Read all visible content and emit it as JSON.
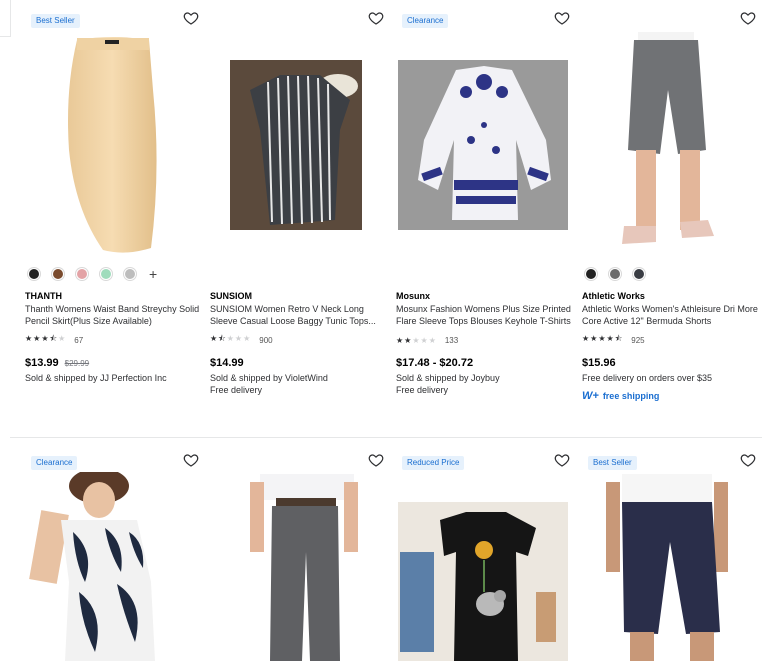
{
  "row1": [
    {
      "badge": "Best Seller",
      "swatches": [
        "#222222",
        "#7a4b2e",
        "#e3a3a6",
        "#9fdcbc",
        "#bdbdbd"
      ],
      "more": "+",
      "brand": "THANTH",
      "title": "Thanth Womens Waist Band Streychy Solid Pencil Skirt(Plus Size Available)",
      "stars": 3.5,
      "reviews": "67",
      "price": "$13.99",
      "was": "$29.99",
      "shipping": [
        "Sold & shipped by JJ Perfection Inc"
      ]
    },
    {
      "badge": "",
      "swatches": [],
      "brand": "SUNSIOM",
      "title": "SUNSIOM Women Retro V Neck Long Sleeve Casual Loose Baggy Tunic Tops...",
      "stars": 1.5,
      "reviews": "900",
      "price": "$14.99",
      "was": "",
      "shipping": [
        "Sold & shipped by VioletWind",
        "Free delivery"
      ]
    },
    {
      "badge": "Clearance",
      "swatches": [],
      "brand": "Mosunx",
      "title": "Mosunx Fashion Womens Plus Size Printed Flare Sleeve Tops Blouses Keyhole T-Shirts",
      "stars": 2,
      "reviews": "133",
      "price": "$17.48 - $20.72",
      "was": "",
      "shipping": [
        "Sold & shipped by Joybuy",
        "Free delivery"
      ]
    },
    {
      "badge": "",
      "swatches": [
        "#222222",
        "#6b6b6b",
        "#3a3d44"
      ],
      "brand": "Athletic Works",
      "title": "Athletic Works Women's Athleisure Dri More Core Active 12\" Bermuda Shorts",
      "stars": 4.5,
      "reviews": "925",
      "price": "$15.96",
      "was": "",
      "shipping": [
        "Free delivery on orders over $35"
      ],
      "wplus_logo": "W+",
      "wplus_text": "free shipping"
    }
  ],
  "row2": [
    {
      "badge": "Clearance"
    },
    {
      "badge": ""
    },
    {
      "badge": "Reduced Price"
    },
    {
      "badge": "Best Seller"
    }
  ],
  "colors": {
    "badge_bg": "#e6f1fc",
    "badge_text": "#1a6ed0",
    "accent": "#1a6ed0"
  }
}
